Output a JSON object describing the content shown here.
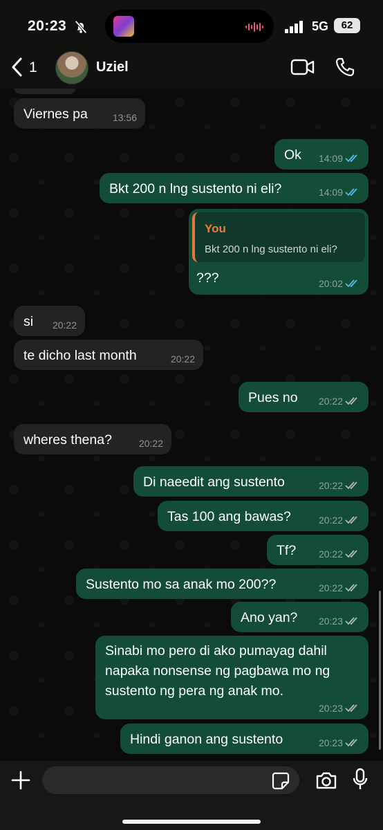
{
  "status": {
    "time": "20:23",
    "network": "5G",
    "battery": "62"
  },
  "header": {
    "back_count": "1",
    "contact_name": "Uziel"
  },
  "messages": [
    {
      "text": "Viernes pa",
      "time": "13:56"
    },
    {
      "text": "Ok",
      "time": "14:09"
    },
    {
      "text": "Bkt 200 n lng sustento ni eli?",
      "time": "14:09"
    },
    {
      "quote_name": "You",
      "quote_text": "Bkt 200 n lng sustento ni eli?",
      "text": "???",
      "time": "20:02"
    },
    {
      "text": "si",
      "time": "20:22"
    },
    {
      "text": "te dicho last month",
      "time": "20:22"
    },
    {
      "text": "Pues no",
      "time": "20:22"
    },
    {
      "text": "wheres thena?",
      "time": "20:22"
    },
    {
      "text": "Di naeedit ang sustento",
      "time": "20:22"
    },
    {
      "text": "Tas 100 ang bawas?",
      "time": "20:22"
    },
    {
      "text": "Tf?",
      "time": "20:22"
    },
    {
      "text": "Sustento mo sa anak mo 200??",
      "time": "20:22"
    },
    {
      "text": "Ano yan?",
      "time": "20:23"
    },
    {
      "text": "Sinabi mo pero di ako pumayag dahil napaka nonsense ng pagbawa mo ng sustento ng pera ng anak mo.",
      "time": "20:23"
    },
    {
      "text": "Hindi ganon ang sustento",
      "time": "20:23"
    }
  ],
  "colors": {
    "incoming": "#232323",
    "outgoing": "#144d37",
    "read_tick": "#53bdeb",
    "delivered_tick": "#b8b8b8",
    "quote_accent": "#f0793b"
  },
  "icons": [
    "bell-slash-icon",
    "signal-icon",
    "back-chevron-icon",
    "video-call-icon",
    "phone-icon",
    "plus-icon",
    "sticker-icon",
    "camera-icon",
    "mic-icon",
    "double-tick-icon"
  ]
}
